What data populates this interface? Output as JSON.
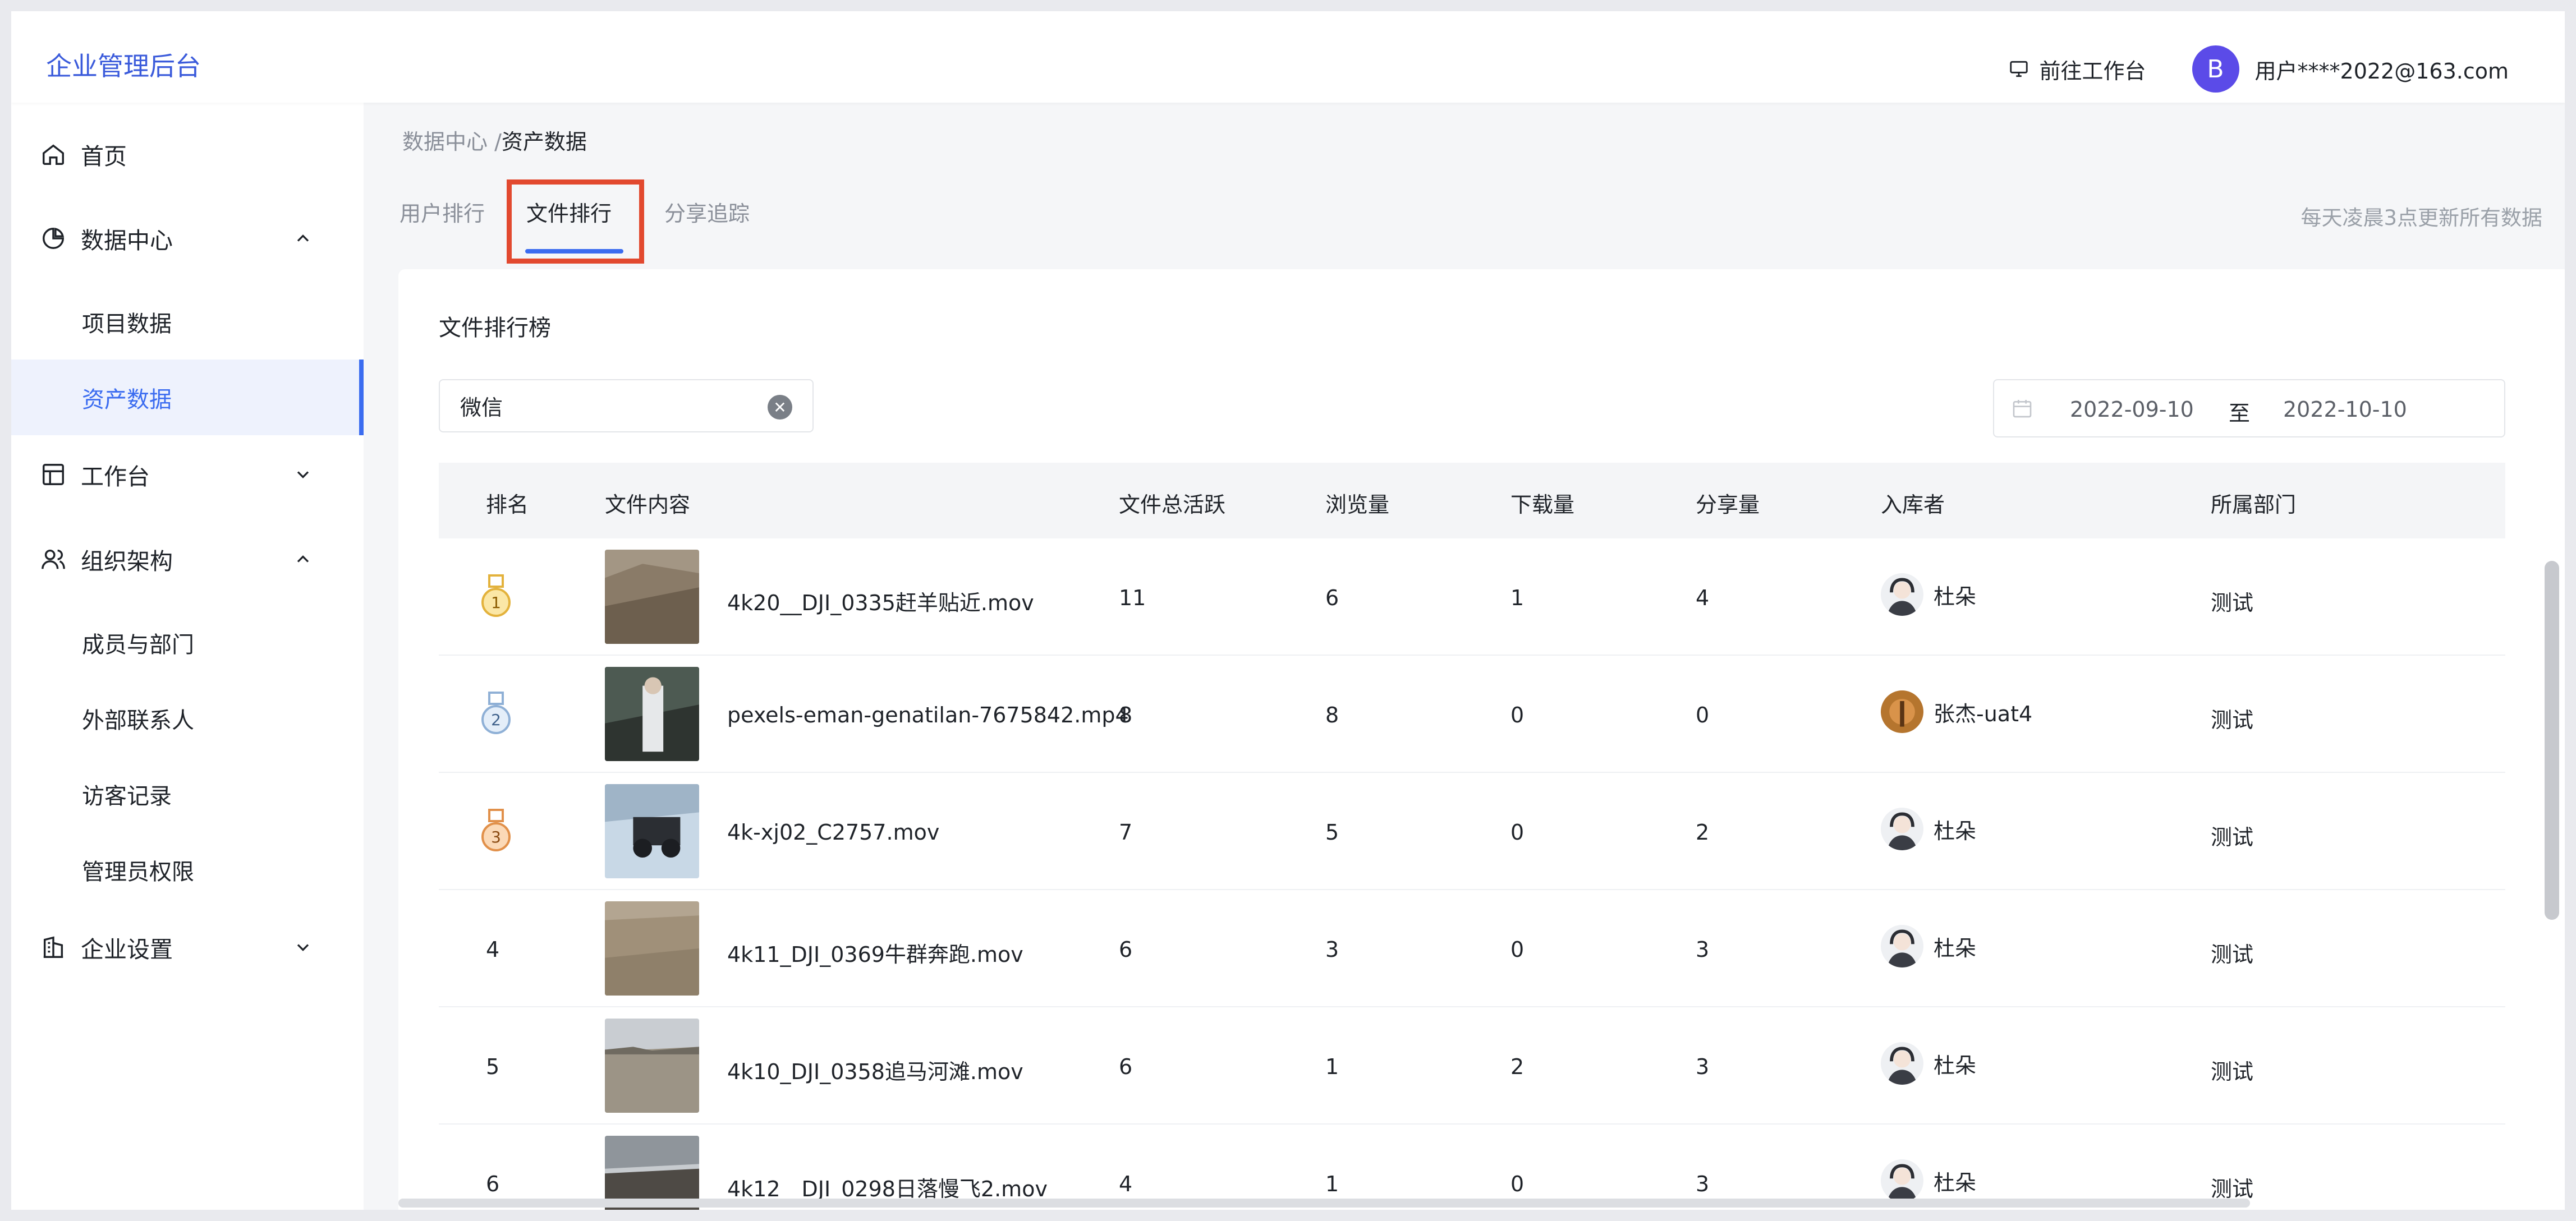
{
  "header": {
    "brand": "企业管理后台",
    "workbench": "前往工作台",
    "avatar_letter": "B",
    "user": "用户****2022@163.com"
  },
  "sidebar": {
    "home": "首页",
    "data_center": "数据中心",
    "project_data": "项目数据",
    "asset_data": "资产数据",
    "workbench": "工作台",
    "org": "组织架构",
    "members": "成员与部门",
    "external": "外部联系人",
    "visitors": "访客记录",
    "admin": "管理员权限",
    "settings": "企业设置"
  },
  "breadcrumb": {
    "parent": "数据中心",
    "sep": "/",
    "current": "资产数据"
  },
  "tabs": [
    "用户排行",
    "文件排行",
    "分享追踪"
  ],
  "update_note": "每天凌晨3点更新所有数据",
  "card": {
    "title": "文件排行榜",
    "search_value": "微信",
    "date_from": "2022-09-10",
    "date_sep": "至",
    "date_to": "2022-10-10"
  },
  "table": {
    "columns": [
      "排名",
      "文件内容",
      "文件总活跃",
      "浏览量",
      "下载量",
      "分享量",
      "入库者",
      "所属部门"
    ],
    "rows": [
      {
        "rank": "1",
        "file": "4k20__DJI_0335赶羊贴近.mov",
        "active": "11",
        "views": "6",
        "downloads": "1",
        "shares": "4",
        "uploader": "杜朵",
        "dept": "测试"
      },
      {
        "rank": "2",
        "file": "pexels-eman-genatilan-7675842.mp4",
        "active": "8",
        "views": "8",
        "downloads": "0",
        "shares": "0",
        "uploader": "张杰-uat4",
        "dept": "测试"
      },
      {
        "rank": "3",
        "file": "4k-xj02_C2757.mov",
        "active": "7",
        "views": "5",
        "downloads": "0",
        "shares": "2",
        "uploader": "杜朵",
        "dept": "测试"
      },
      {
        "rank": "4",
        "file": "4k11_DJI_0369牛群奔跑.mov",
        "active": "6",
        "views": "3",
        "downloads": "0",
        "shares": "3",
        "uploader": "杜朵",
        "dept": "测试"
      },
      {
        "rank": "5",
        "file": "4k10_DJI_0358追马河滩.mov",
        "active": "6",
        "views": "1",
        "downloads": "2",
        "shares": "3",
        "uploader": "杜朵",
        "dept": "测试"
      },
      {
        "rank": "6",
        "file": "4k12__DJI_0298日落慢飞2.mov",
        "active": "4",
        "views": "1",
        "downloads": "0",
        "shares": "3",
        "uploader": "杜朵",
        "dept": "测试"
      }
    ]
  }
}
